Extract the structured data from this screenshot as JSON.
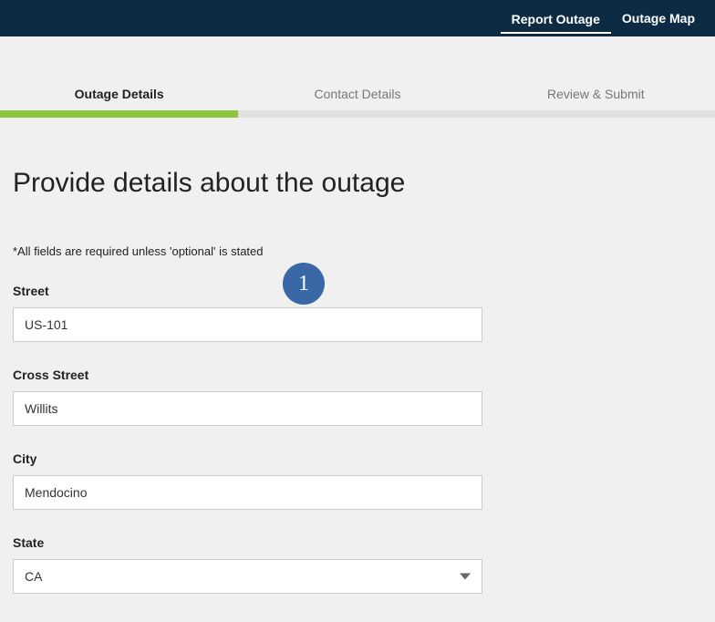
{
  "nav": {
    "report": "Report Outage",
    "map": "Outage Map"
  },
  "steps": {
    "s1": "Outage Details",
    "s2": "Contact Details",
    "s3": "Review & Submit"
  },
  "title": "Provide details about the outage",
  "hint": "*All fields are required unless 'optional' is stated",
  "form": {
    "street_label": "Street",
    "street_value": "US-101",
    "cross_label": "Cross Street",
    "cross_value": "Willits",
    "city_label": "City",
    "city_value": "Mendocino",
    "state_label": "State",
    "state_value": "CA"
  },
  "badge": "1"
}
